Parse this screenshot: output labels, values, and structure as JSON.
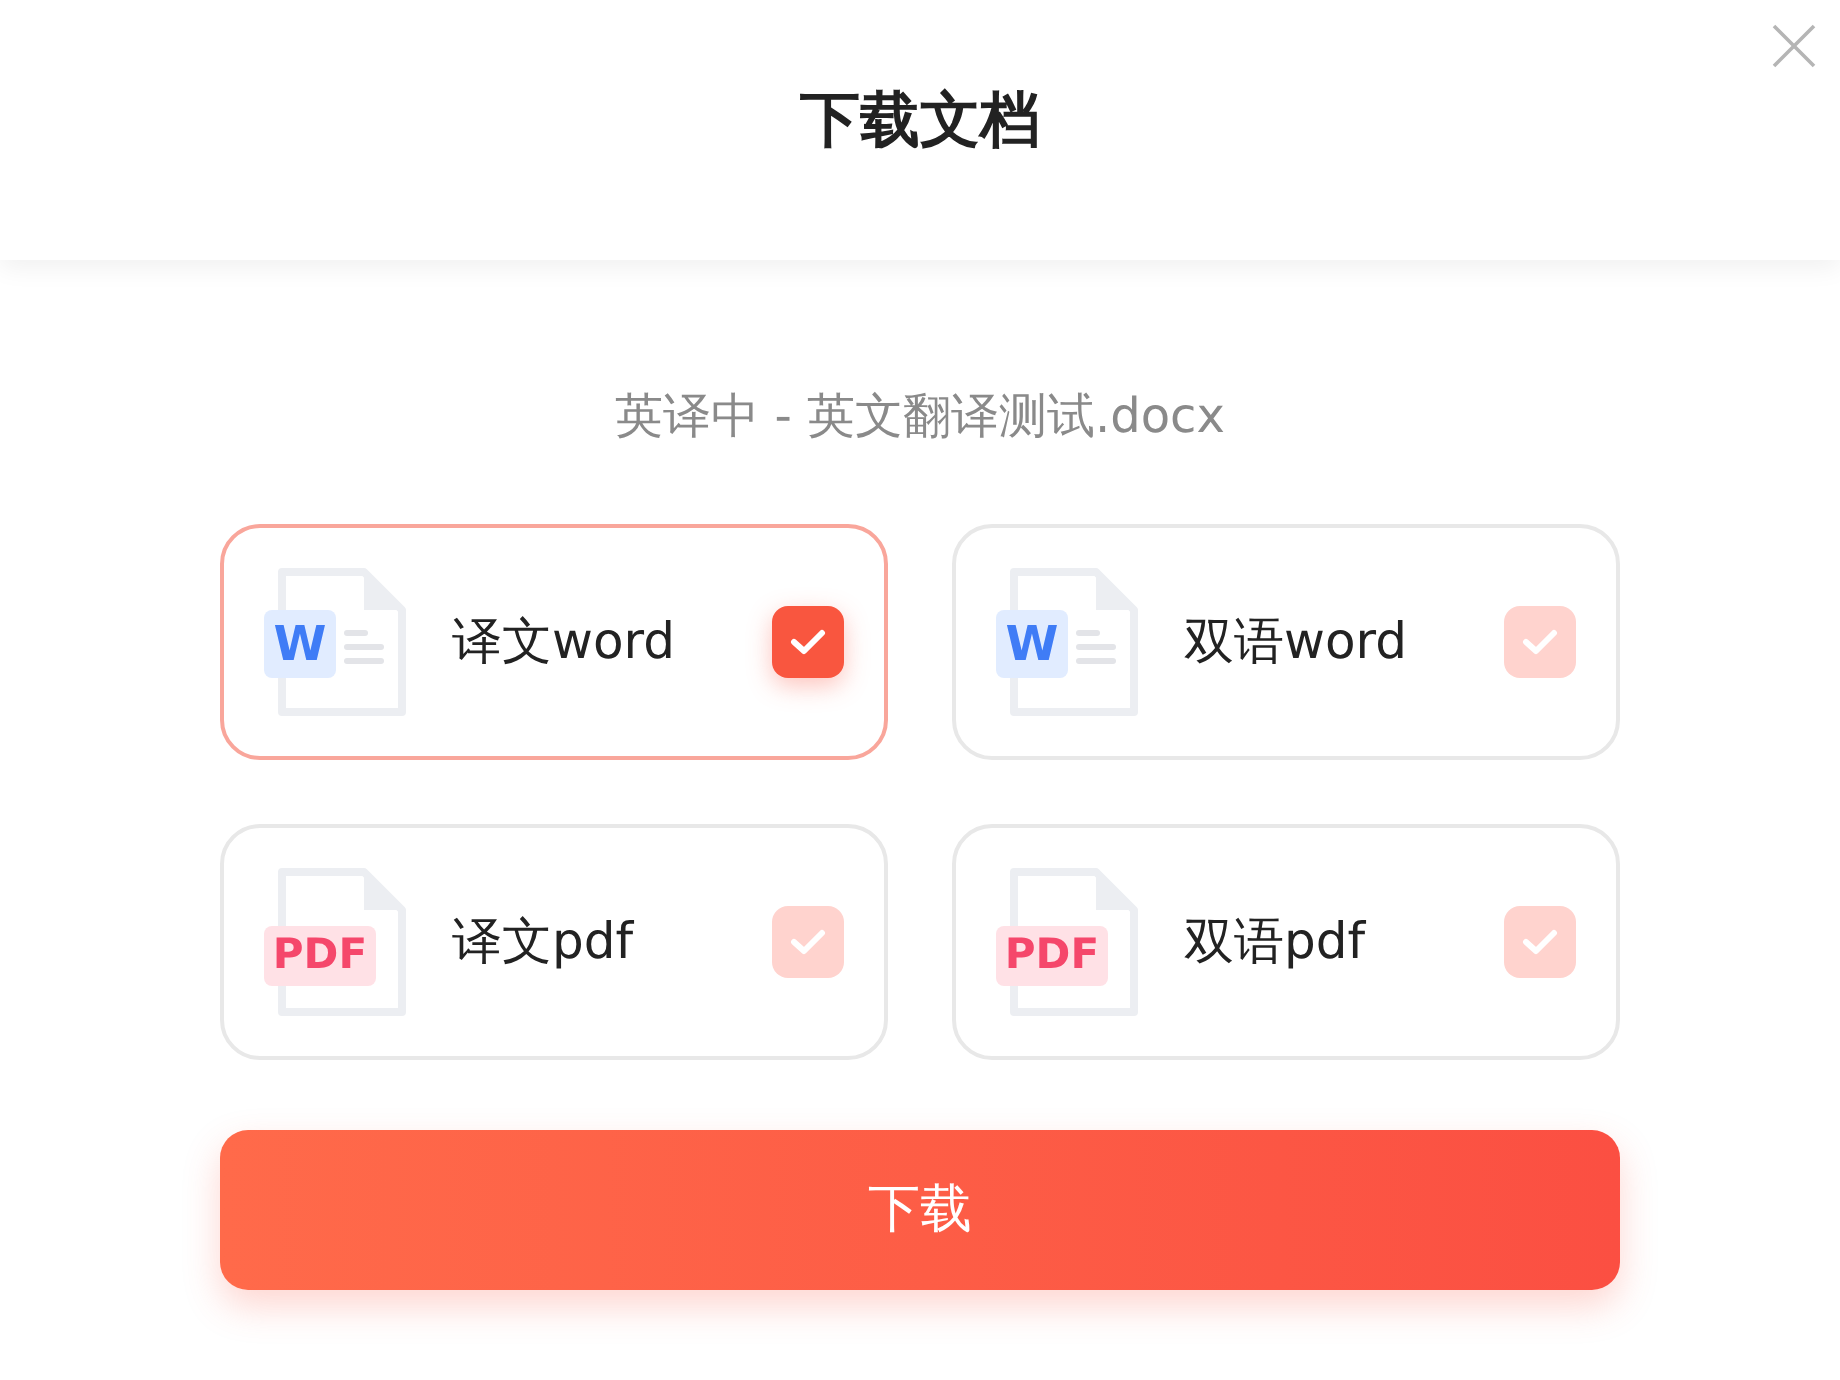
{
  "dialog": {
    "title": "下载文档"
  },
  "file_name": "英译中 - 英文翻译测试.docx",
  "options": [
    {
      "kind": "word",
      "badge": "W",
      "label": "译文word",
      "selected": true
    },
    {
      "kind": "word",
      "badge": "W",
      "label": "双语word",
      "selected": false
    },
    {
      "kind": "pdf",
      "badge": "PDF",
      "label": "译文pdf",
      "selected": false
    },
    {
      "kind": "pdf",
      "badge": "PDF",
      "label": "双语pdf",
      "selected": false
    }
  ],
  "download_button": "下载"
}
